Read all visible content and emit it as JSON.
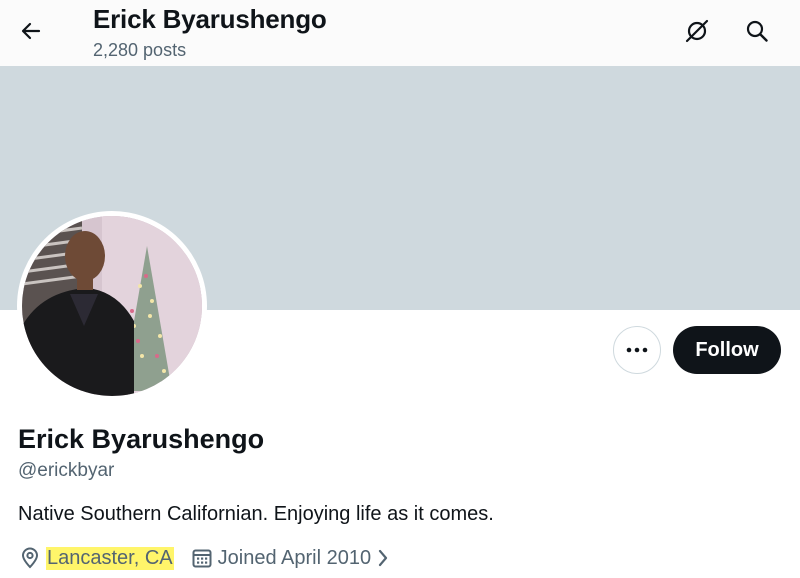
{
  "header": {
    "name": "Erick Byarushengo",
    "posts_count": "2,280 posts"
  },
  "profile": {
    "display_name": "Erick Byarushengo",
    "handle": "@erickbyar",
    "bio": "Native Southern Californian. Enjoying life as it comes.",
    "location": "Lancaster, CA",
    "joined": "Joined April 2010"
  },
  "actions": {
    "follow_label": "Follow"
  },
  "icons": {
    "back": "back-arrow-icon",
    "grok": "grok-icon",
    "search": "search-icon",
    "more": "more-horizontal-icon",
    "location": "location-pin-icon",
    "calendar": "calendar-icon",
    "chevron": "chevron-right-icon"
  },
  "colors": {
    "banner": "#cfd9de",
    "follow_bg": "#0f1419",
    "secondary_text": "#536471",
    "highlight": "#fff56a"
  }
}
